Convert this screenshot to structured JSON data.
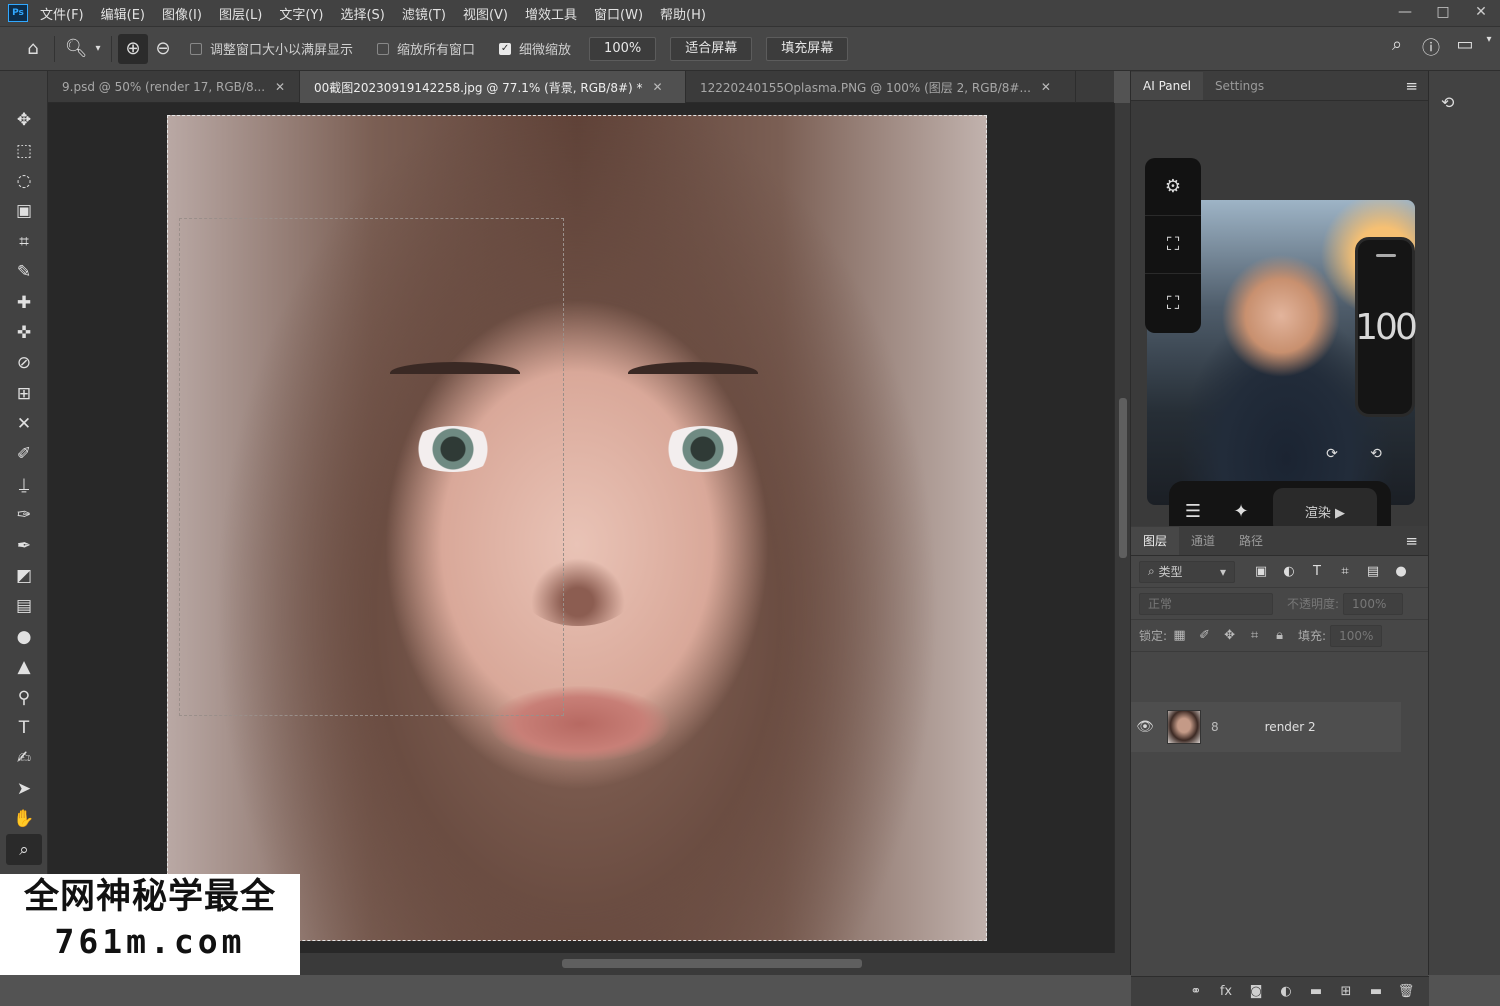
{
  "menubar": {
    "logo": "Ps",
    "items": [
      "文件(F)",
      "编辑(E)",
      "图像(I)",
      "图层(L)",
      "文字(Y)",
      "选择(S)",
      "滤镜(T)",
      "视图(V)",
      "增效工具",
      "窗口(W)",
      "帮助(H)"
    ],
    "window_controls": [
      "—",
      "□",
      "✕"
    ]
  },
  "options": {
    "chk_resize": "调整窗口大小以满屏显示",
    "chk_zoom_all": "缩放所有窗口",
    "chk_scrubby": "细微缩放",
    "btn_100": "100%",
    "btn_fit": "适合屏幕",
    "btn_fill": "填充屏幕"
  },
  "tabs": [
    {
      "label": "9.psd @ 50% (render 17, RGB/8...",
      "close": "✕"
    },
    {
      "label": "00截图20230919142258.jpg @ 77.1% (背景, RGB/8#) *",
      "close": "✕"
    },
    {
      "label": "12220240155Oplasma.PNG @ 100% (图层 2, RGB/8#...",
      "close": "✕"
    }
  ],
  "ai_panel": {
    "tabs": [
      "AI Panel",
      "Settings"
    ],
    "slider_value": "100",
    "render_label": "渲染 ▶"
  },
  "layers_panel": {
    "tabs": [
      "图层",
      "通道",
      "路径"
    ],
    "filter_kind": "类型",
    "blend_mode": "正常",
    "opacity_label": "不透明度:",
    "opacity_value": "100%",
    "lock_label": "锁定:",
    "fill_label": "填充:",
    "fill_value": "100%",
    "layers": [
      {
        "name": "render 2",
        "link": "8"
      }
    ]
  },
  "watermark": {
    "line1": "全网神秘学最全",
    "line2": "761m.com"
  }
}
